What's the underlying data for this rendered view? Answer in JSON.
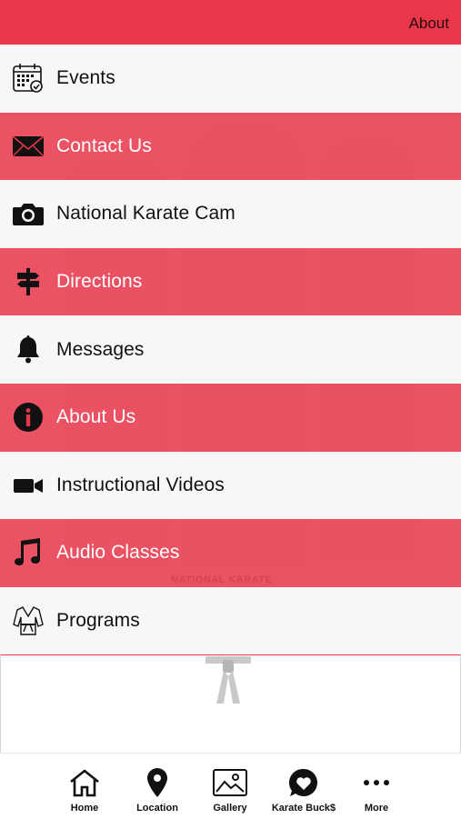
{
  "header": {
    "link_label": "About"
  },
  "menu": {
    "items": [
      {
        "label": "Events",
        "icon": "calendar-icon",
        "style": "light"
      },
      {
        "label": "Contact Us",
        "icon": "envelope-icon",
        "style": "red"
      },
      {
        "label": "National Karate Cam",
        "icon": "camera-icon",
        "style": "light"
      },
      {
        "label": "Directions",
        "icon": "signpost-icon",
        "style": "red"
      },
      {
        "label": "Messages",
        "icon": "bell-icon",
        "style": "light"
      },
      {
        "label": "About Us",
        "icon": "info-icon",
        "style": "red"
      },
      {
        "label": "Instructional Videos",
        "icon": "video-camera-icon",
        "style": "light"
      },
      {
        "label": "Audio Classes",
        "icon": "music-note-icon",
        "style": "red"
      },
      {
        "label": "Programs",
        "icon": "karate-gi-icon",
        "style": "light"
      }
    ]
  },
  "background": {
    "logo_text": "NATIONAL KARATE"
  },
  "tabbar": {
    "tabs": [
      {
        "label": "Home",
        "icon": "home-icon"
      },
      {
        "label": "Location",
        "icon": "map-pin-icon"
      },
      {
        "label": "Gallery",
        "icon": "image-icon"
      },
      {
        "label": "Karate Buck$",
        "icon": "heart-bubble-icon"
      },
      {
        "label": "More",
        "icon": "more-dots-icon"
      }
    ]
  },
  "colors": {
    "accent": "#e9374a",
    "light_row": "#f7f7f7",
    "text": "#111111"
  }
}
